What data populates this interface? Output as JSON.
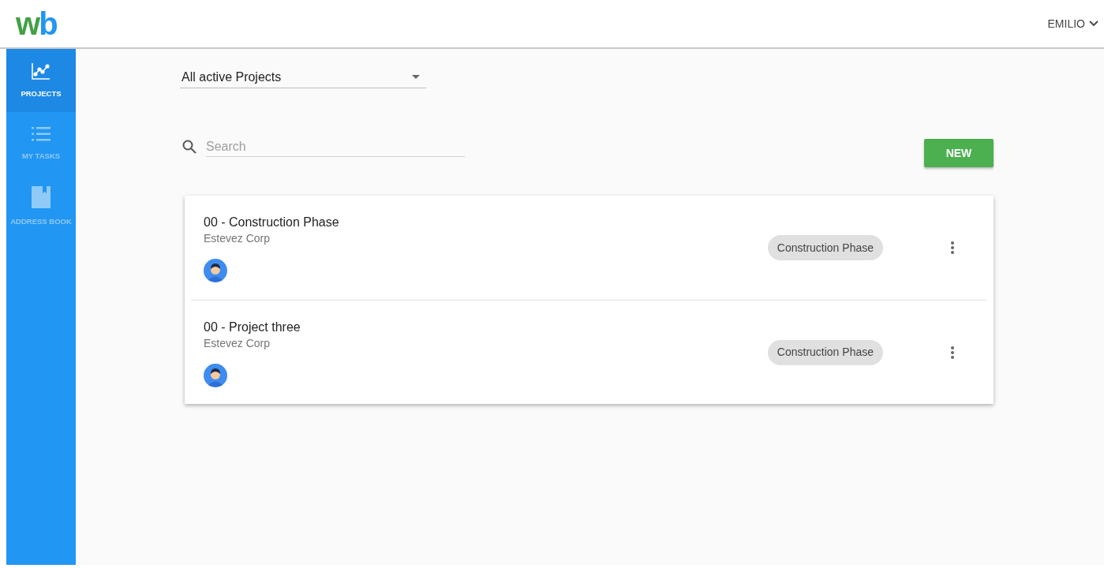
{
  "logo": {
    "letters": [
      {
        "text": "w",
        "color": "#43a047"
      },
      {
        "text": "b",
        "color": "#2196f3"
      }
    ]
  },
  "user_menu": {
    "label": "EMILIO"
  },
  "sidebar": {
    "items": [
      {
        "kind": "chart",
        "label": "PROJECTS",
        "selected": true
      },
      {
        "kind": "list",
        "label": "MY TASKS",
        "selected": false
      },
      {
        "kind": "book",
        "label": "ADDRESS BOOK",
        "selected": false
      }
    ]
  },
  "filter": {
    "value": "All active Projects"
  },
  "search": {
    "placeholder": "Search"
  },
  "new_button": {
    "label": "NEW"
  },
  "projects": [
    {
      "title": "00 - Construction Phase",
      "client": "Estevez Corp",
      "phase": "Construction Phase"
    },
    {
      "title": "00 - Project three",
      "client": "Estevez Corp",
      "phase": "Construction Phase"
    }
  ]
}
